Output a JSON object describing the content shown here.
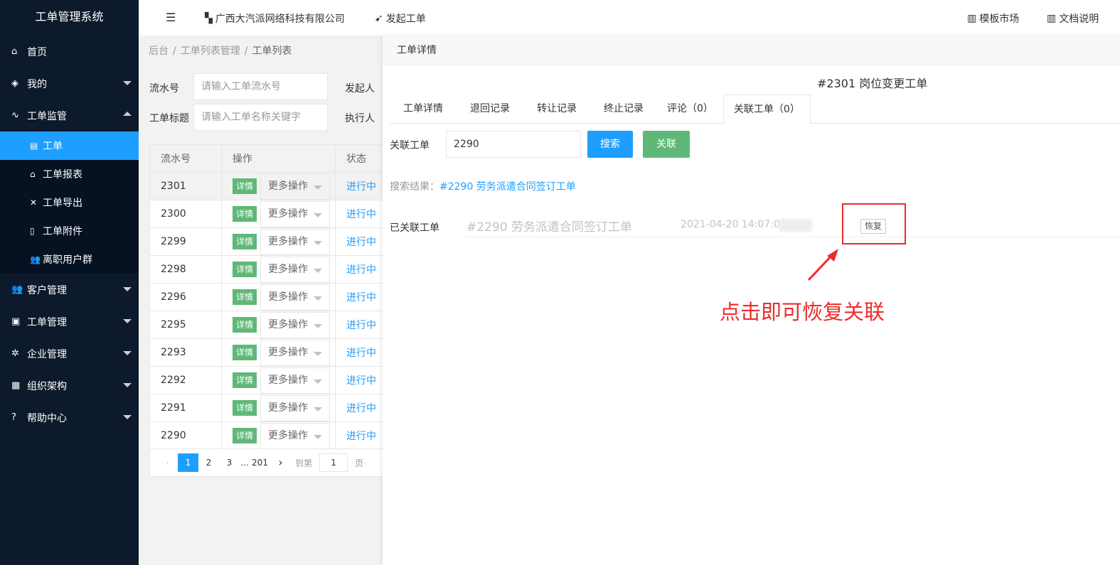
{
  "app": {
    "title": "工单管理系统"
  },
  "sidebar": {
    "items": [
      {
        "label": "首页",
        "icon": "home-icon"
      },
      {
        "label": "我的",
        "icon": "layers-icon"
      },
      {
        "label": "工单监管",
        "icon": "pulse-icon",
        "children": [
          {
            "label": "工单",
            "icon": "file-icon"
          },
          {
            "label": "工单报表",
            "icon": "home-icon"
          },
          {
            "label": "工单导出",
            "icon": "tools-icon"
          },
          {
            "label": "工单附件",
            "icon": "file-icon"
          },
          {
            "label": "离职用户群",
            "icon": "users-icon"
          }
        ]
      },
      {
        "label": "客户管理",
        "icon": "users-icon"
      },
      {
        "label": "工单管理",
        "icon": "clipboard-icon"
      },
      {
        "label": "企业管理",
        "icon": "gear-icon"
      },
      {
        "label": "组织架构",
        "icon": "calendar-icon"
      },
      {
        "label": "帮助中心",
        "icon": "question-icon"
      }
    ]
  },
  "header": {
    "company": "广西大汽派网络科技有限公司",
    "start_order": "发起工单",
    "template_market": "模板市场",
    "docs": "文档说明"
  },
  "list_page": {
    "breadcrumb": [
      "后台",
      "工单列表管理",
      "工单列表"
    ],
    "filters": {
      "serial_label": "流水号",
      "serial_placeholder": "请输入工单流水号",
      "initiator_label": "发起人",
      "title_label": "工单标题",
      "title_placeholder": "请输入工单名称关键字",
      "executor_label": "执行人"
    },
    "table": {
      "headers": [
        "流水号",
        "操作",
        "状态"
      ],
      "detail_label": "详情",
      "more_label": "更多操作",
      "rows": [
        {
          "id": "2301",
          "status": "进行中"
        },
        {
          "id": "2300",
          "status": "进行中"
        },
        {
          "id": "2299",
          "status": "进行中"
        },
        {
          "id": "2298",
          "status": "进行中"
        },
        {
          "id": "2296",
          "status": "进行中"
        },
        {
          "id": "2295",
          "status": "进行中"
        },
        {
          "id": "2293",
          "status": "进行中"
        },
        {
          "id": "2292",
          "status": "进行中"
        },
        {
          "id": "2291",
          "status": "进行中"
        },
        {
          "id": "2290",
          "status": "进行中"
        }
      ]
    },
    "pager": {
      "pages": [
        "1",
        "2",
        "3",
        "…",
        "201"
      ],
      "current": "1",
      "goto_label": "到第",
      "goto_value": "1",
      "page_suffix": "页"
    }
  },
  "detail_panel": {
    "title": "工单详情",
    "order_title": "#2301 岗位变更工单",
    "tabs": [
      "工单详情",
      "退回记录",
      "转让记录",
      "终止记录",
      "评论（0）",
      "关联工单（0）"
    ],
    "active_tab": 5,
    "link_label": "关联工单",
    "link_input_value": "2290",
    "search_button": "搜索",
    "link_button": "关联",
    "search_result_label": "搜索结果：",
    "search_result_link": "#2290 劳务派遣合同签订工单",
    "linked_label": "已关联工单",
    "linked_item": {
      "name": "#2290 劳务派遣合同签订工单",
      "time": "2021-04-20 14:07:09",
      "restore_label": "恢复"
    },
    "annotation": "点击即可恢复关联"
  },
  "colors": {
    "sidebar_bg": "#0c1a2c",
    "accent": "#1e9fff",
    "success": "#5fb878",
    "annotation_red": "#ec2c2c"
  }
}
